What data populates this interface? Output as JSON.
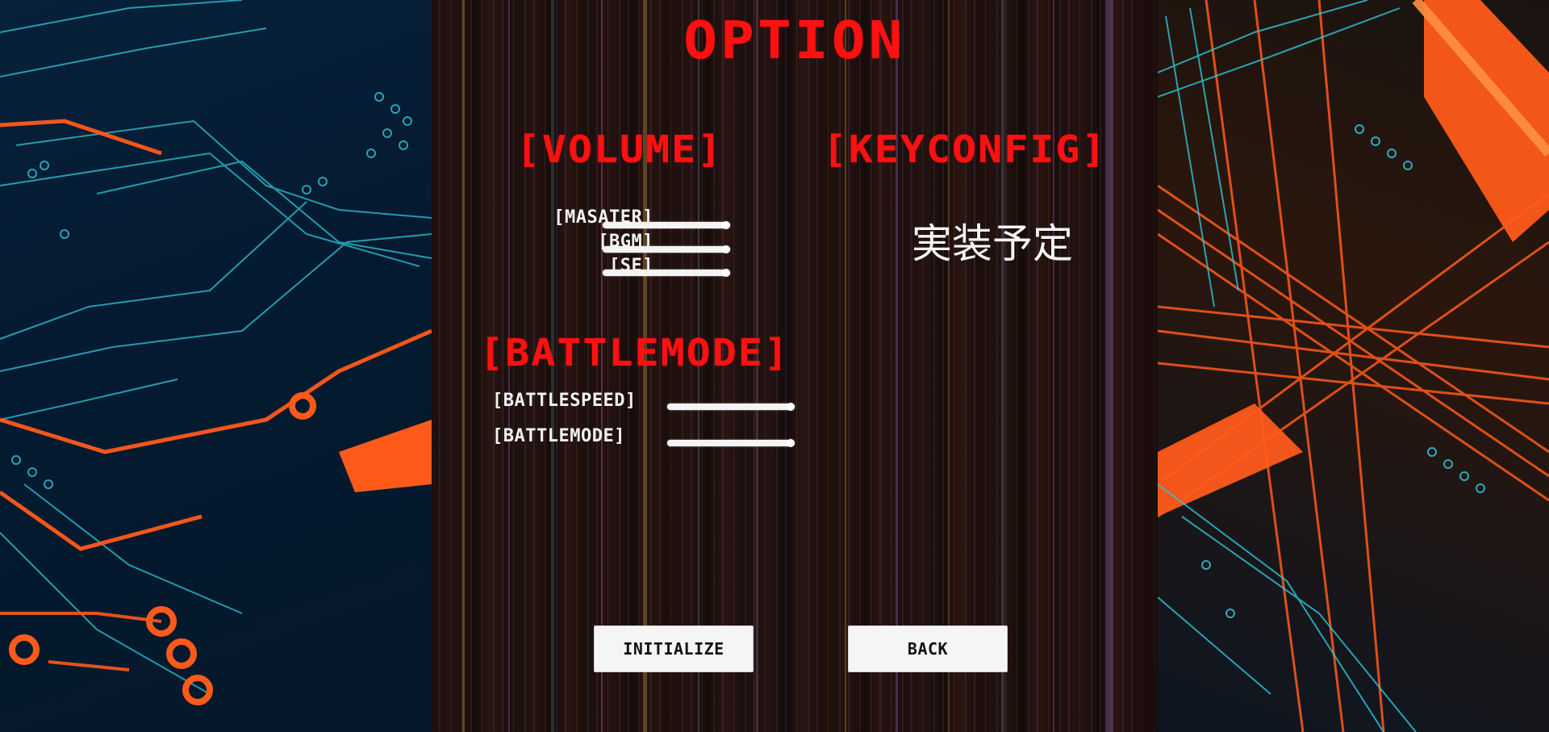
{
  "screen": {
    "title": "OPTION"
  },
  "volume": {
    "heading": "[VOLUME]",
    "rows": [
      {
        "label": "[MASATER]",
        "value": 1.0
      },
      {
        "label": "[BGM]",
        "value": 1.0
      },
      {
        "label": "[SE]",
        "value": 1.0
      }
    ]
  },
  "keyconfig": {
    "heading": "[KEYCONFIG]",
    "notice": "実装予定"
  },
  "battlemode": {
    "heading": "[BATTLEMODE]",
    "rows": [
      {
        "label": "[BATTLESPEED]",
        "value": 1.0
      },
      {
        "label": "[BATTLEMODE]",
        "value": 1.0
      }
    ]
  },
  "buttons": {
    "initialize": "INITIALIZE",
    "back": "BACK"
  },
  "colors": {
    "accent": "#ff1111",
    "label": "#f2f2f2",
    "button_bg": "#f5f5f5",
    "circuit_left": "#2ec6d8",
    "circuit_right": "#ff5a1a"
  }
}
